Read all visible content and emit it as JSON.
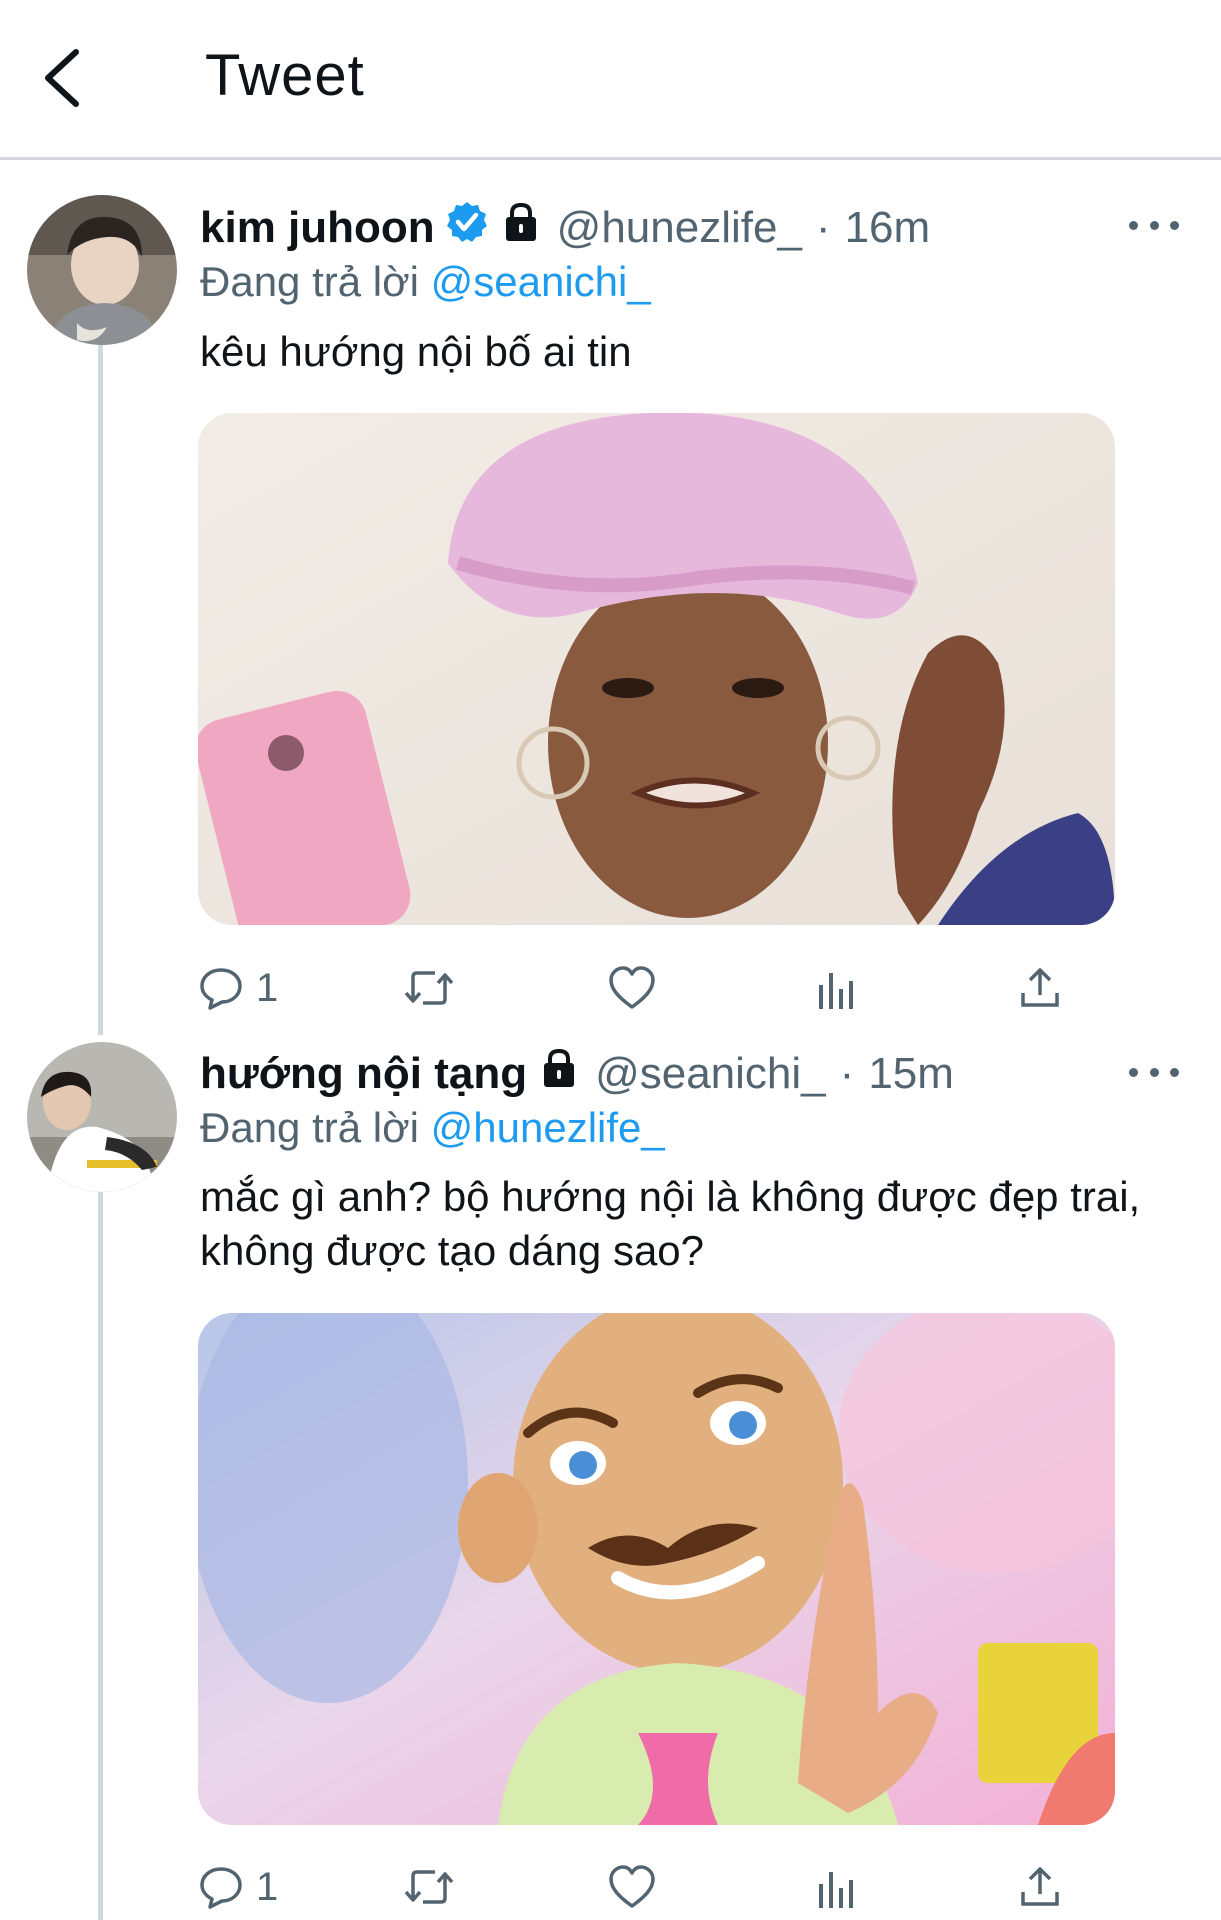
{
  "header": {
    "title": "Tweet",
    "back_icon": "back-arrow-icon"
  },
  "colors": {
    "link": "#1d9bf0",
    "muted": "#536471",
    "text": "#0f1419",
    "divider": "#d3d6da"
  },
  "tweets": [
    {
      "display_name": "kim juhoon",
      "verified": true,
      "protected": true,
      "handle": "@hunezlife_",
      "separator": "·",
      "time": "16m",
      "replying_prefix": "Đang trả lời",
      "replying_to": "@seanichi_",
      "text": "kêu hướng nội bố ai tin",
      "media": "meme-photo-shower-cap",
      "reply_count": "1"
    },
    {
      "display_name": "hướng nội tạng",
      "verified": false,
      "protected": true,
      "handle": "@seanichi_",
      "separator": "·",
      "time": "15m",
      "replying_prefix": "Đang trả lời",
      "replying_to": "@hunezlife_",
      "text": "mắc gì anh? bộ hướng nội là không được đẹp trai, không được tạo dáng sao?",
      "media": "meme-cartoon-mustache-man",
      "reply_count": "1"
    }
  ]
}
